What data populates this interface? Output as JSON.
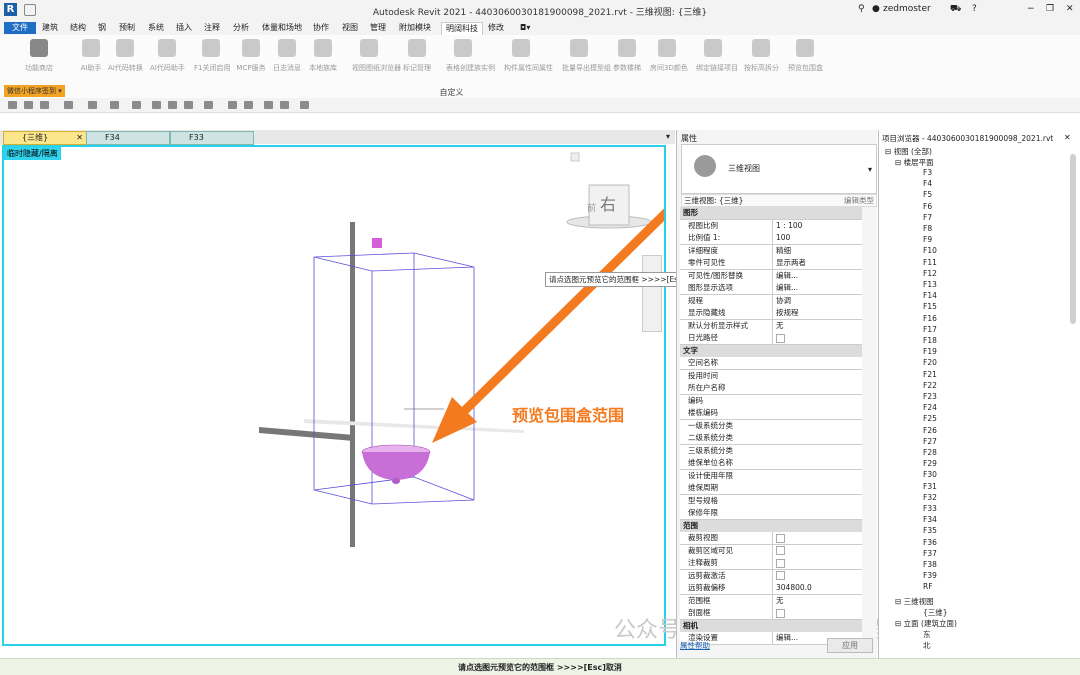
{
  "app": {
    "title": "Autodesk Revit 2021 - 4403060030181900098_2021.rvt - 三维视图: {三维}",
    "logo": "R",
    "user": "zedmoster",
    "help": "?"
  },
  "tabs": [
    "文件",
    "建筑",
    "结构",
    "钢",
    "预制",
    "系统",
    "插入",
    "注释",
    "分析",
    "体量和场地",
    "协作",
    "视图",
    "管理",
    "附加模块",
    "明阔科技",
    "修改"
  ],
  "active_tab": "明阔科技",
  "ribbon": {
    "buttons": [
      "功能商店",
      "AI助手",
      "AI代码转换",
      "AI代码助手",
      "F1关闭启用",
      "MCP服务",
      "日志消息",
      "本地族库",
      "视图图纸浏览器",
      "标记管理",
      "表格创建族实例",
      "构件属性同属性",
      "批量导出模型组",
      "参数楼梯",
      "房间3D颜色",
      "绑定链接项目",
      "按标高拆分",
      "预览包围盒"
    ],
    "panel_name": "自定义",
    "mini_program": "微信小程序签到 ▾"
  },
  "view_tabs": [
    {
      "label": "{三维}",
      "active": true
    },
    {
      "label": "F34",
      "active": false
    },
    {
      "label": "F33",
      "active": false
    }
  ],
  "viewport": {
    "temp_badge": "临时隐藏/隔离",
    "tooltip": "请点选图元预览它的范围框 >>>>[Esc]取消",
    "annotation": "预览包围盒范围",
    "viewcube_label": "右",
    "viewcube_side": "前",
    "watermark": "公众号 · Revit二次开发教程",
    "arrow_color": "#f47a20",
    "frame_color": "#28d0ea"
  },
  "properties": {
    "panel_title": "属性",
    "type_name": "三维视图",
    "selector": "三维视图: {三维}",
    "edit_type": "编辑类型",
    "rows": [
      {
        "section": "图形"
      },
      {
        "k": "视图比例",
        "v": "1 : 100"
      },
      {
        "k": "比例值 1:",
        "v": "100"
      },
      {
        "k": "详细程度",
        "v": "精细"
      },
      {
        "k": "零件可见性",
        "v": "显示两者"
      },
      {
        "k": "可见性/图形替换",
        "v": "编辑..."
      },
      {
        "k": "图形显示选项",
        "v": "编辑..."
      },
      {
        "k": "规程",
        "v": "协调"
      },
      {
        "k": "显示隐藏线",
        "v": "按规程"
      },
      {
        "k": "默认分析显示样式",
        "v": "无"
      },
      {
        "k": "日光路径",
        "cb": true
      },
      {
        "section": "文字"
      },
      {
        "k": "空间名称",
        "v": ""
      },
      {
        "k": "投用时间",
        "v": ""
      },
      {
        "k": "所在户名称",
        "v": ""
      },
      {
        "k": "编码",
        "v": ""
      },
      {
        "k": "楼栋编码",
        "v": ""
      },
      {
        "k": "一级系统分类",
        "v": ""
      },
      {
        "k": "二级系统分类",
        "v": ""
      },
      {
        "k": "三级系统分类",
        "v": ""
      },
      {
        "k": "维保单位名称",
        "v": ""
      },
      {
        "k": "设计使用年限",
        "v": ""
      },
      {
        "k": "维保周期",
        "v": ""
      },
      {
        "k": "型号规格",
        "v": ""
      },
      {
        "k": "保修年限",
        "v": ""
      },
      {
        "section": "范围"
      },
      {
        "k": "裁剪视图",
        "cb": true
      },
      {
        "k": "裁剪区域可见",
        "cb": true
      },
      {
        "k": "注释裁剪",
        "cb": true
      },
      {
        "k": "远剪裁激活",
        "cb": true
      },
      {
        "k": "远剪裁偏移",
        "v": "304800.0"
      },
      {
        "k": "范围框",
        "v": "无"
      },
      {
        "k": "剖面框",
        "cb": true
      },
      {
        "section": "相机"
      },
      {
        "k": "渲染设置",
        "v": "编辑..."
      }
    ],
    "help_link": "属性帮助",
    "apply": "应用"
  },
  "browser": {
    "title": "项目浏览器 - 4403060030181900098_2021.rvt",
    "root": "视图 (全部)",
    "floorplans": "楼层平面",
    "levels": [
      "F3",
      "F4",
      "F5",
      "F6",
      "F7",
      "F8",
      "F9",
      "F10",
      "F11",
      "F12",
      "F13",
      "F14",
      "F15",
      "F16",
      "F17",
      "F18",
      "F19",
      "F20",
      "F21",
      "F22",
      "F23",
      "F24",
      "F25",
      "F26",
      "F27",
      "F28",
      "F29",
      "F30",
      "F31",
      "F32",
      "F33",
      "F34",
      "F35",
      "F36",
      "F37",
      "F38",
      "F39",
      "RF"
    ],
    "threeD": "三维视图",
    "threeD_item": "{三维}",
    "elev": "立面 (建筑立面)",
    "elev_items": [
      "东",
      "北"
    ]
  },
  "status": {
    "text": "请点选图元预览它的范围框 >>>>[Esc]取消"
  }
}
